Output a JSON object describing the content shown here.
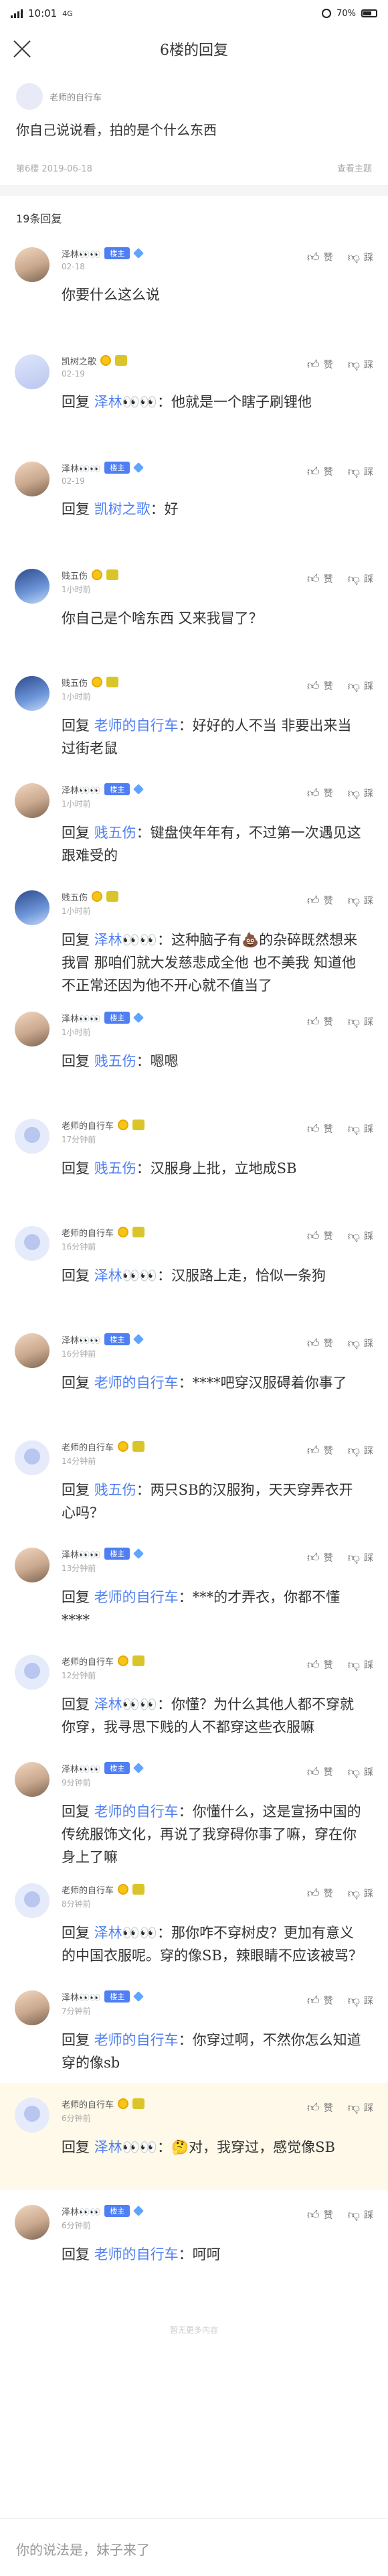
{
  "status": {
    "time": "10:01",
    "signal_a": "4G",
    "signal_b": "4G",
    "battery": "70%"
  },
  "nav": {
    "title": "6楼的回复"
  },
  "post": {
    "author": "老师的自行车",
    "text": "你自己说说看，拍的是个什么东西",
    "floor_date": "第6楼 2019-06-18",
    "see_main": "查看主题"
  },
  "reply_count": "19条回复",
  "like_label": "赞",
  "dislike_label": "踩",
  "owner_badge": "楼主",
  "reply_prefix": "回复",
  "replies": [
    {
      "name": "泽林👀👀",
      "time": "02-18",
      "owner": true,
      "content": "你要什么这么说"
    },
    {
      "name": "凯树之歌",
      "time": "02-19",
      "owner": false,
      "to": "泽林👀👀",
      "content": "：他就是一个瞎子刷锂他"
    },
    {
      "name": "泽林👀👀",
      "time": "02-19",
      "owner": true,
      "to": "凯树之歌",
      "content": "：好"
    },
    {
      "name": "贱五伤",
      "time": "1小时前",
      "owner": false,
      "content": "你自己是个啥东西 又来我冒了？"
    },
    {
      "name": "贱五伤",
      "time": "1小时前",
      "owner": false,
      "to": "老师的自行车",
      "content": "：好好的人不当 非要出来当过街老鼠"
    },
    {
      "name": "泽林👀👀",
      "time": "1小时前",
      "owner": true,
      "to": "贱五伤",
      "content": "：键盘侠年年有，不过第一次遇见这跟难受的"
    },
    {
      "name": "贱五伤",
      "time": "1小时前",
      "owner": false,
      "to": "泽林👀👀",
      "content": "：这种脑子有💩的杂碎既然想来我冒 那咱们就大发慈悲成全他 也不美我 知道他不正常还因为他不开心就不值当了"
    },
    {
      "name": "泽林👀👀",
      "time": "1小时前",
      "owner": true,
      "to": "贱五伤",
      "content": "：嗯嗯"
    },
    {
      "name": "老师的自行车",
      "time": "17分钟前",
      "owner": false,
      "to": "贱五伤",
      "content": "：汉服身上批，立地成SB"
    },
    {
      "name": "老师的自行车",
      "time": "16分钟前",
      "owner": false,
      "to": "泽林👀👀",
      "content": "：汉服路上走，恰似一条狗"
    },
    {
      "name": "泽林👀👀",
      "time": "16分钟前",
      "owner": true,
      "to": "老师的自行车",
      "content": "：****吧穿汉服碍着你事了"
    },
    {
      "name": "老师的自行车",
      "time": "14分钟前",
      "owner": false,
      "to": "贱五伤",
      "content": "：两只SB的汉服狗，天天穿弄衣开心吗？"
    },
    {
      "name": "泽林👀👀",
      "time": "13分钟前",
      "owner": true,
      "to": "老师的自行车",
      "content": "：***的才弄衣，你都不懂****"
    },
    {
      "name": "老师的自行车",
      "time": "12分钟前",
      "owner": false,
      "to": "泽林👀👀",
      "content": "：你懂？为什么其他人都不穿就你穿，我寻思下贱的人不都穿这些衣服嘛"
    },
    {
      "name": "泽林👀👀",
      "time": "9分钟前",
      "owner": true,
      "to": "老师的自行车",
      "content": "：你懂什么，这是宣扬中国的传统服饰文化，再说了我穿碍你事了嘛，穿在你身上了嘛"
    },
    {
      "name": "老师的自行车",
      "time": "8分钟前",
      "owner": false,
      "to": "泽林👀👀",
      "content": "：那你咋不穿树皮？更加有意义的中国衣服呢。穿的像SB，辣眼睛不应该被骂？"
    },
    {
      "name": "泽林👀👀",
      "time": "7分钟前",
      "owner": true,
      "to": "老师的自行车",
      "content": "：你穿过啊，不然你怎么知道穿的像sb"
    },
    {
      "name": "老师的自行车",
      "time": "6分钟前",
      "owner": false,
      "to": "泽林👀👀",
      "content": "：🤔对，我穿过，感觉像SB",
      "highlight": true
    },
    {
      "name": "泽林👀👀",
      "time": "6分钟前",
      "owner": true,
      "to": "老师的自行车",
      "content": "：呵呵"
    }
  ],
  "end_text": "暂无更多内容",
  "comment_placeholder": "你的说法是，妹子来了"
}
